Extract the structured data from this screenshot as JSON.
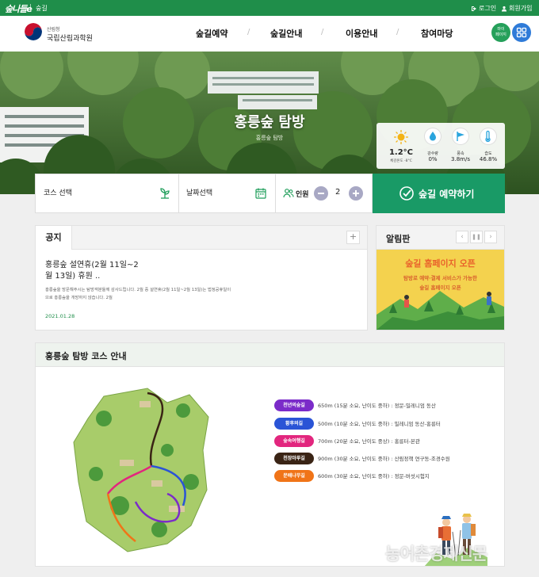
{
  "topbar": {
    "logo": "숲나들e",
    "breadcrumb": "숲길",
    "login": "로그인",
    "join": "회원가입"
  },
  "header": {
    "org_top": "산림청",
    "org_name": "국립산림과학원",
    "nav": [
      "숲길예약",
      "숲길안내",
      "이용안내",
      "참여마당"
    ],
    "mypage": [
      "마이",
      "페이지"
    ]
  },
  "hero": {
    "title": "홍릉숲 탐방",
    "subtitle": "홍릉숲 탐방"
  },
  "weather": {
    "temp": "1.2°C",
    "feels": "체감온도 -8°C",
    "items": [
      {
        "label": "강수량",
        "value": "0%",
        "icon": "raindrop-icon"
      },
      {
        "label": "풍속",
        "value": "3.8m/s",
        "icon": "wind-flag-icon"
      },
      {
        "label": "습도",
        "value": "46.8%",
        "icon": "humidity-icon"
      }
    ]
  },
  "search": {
    "course": "코스 선택",
    "date": "날짜선택",
    "people_label": "인원",
    "people_count": "2",
    "reserve": "숲길 예약하기"
  },
  "notice": {
    "tab": "공지",
    "plus": "+",
    "title": "홍릉숲 설연휴(2월 11일~2월 13일) 휴원 ..",
    "body": "홍릉숲을 방문해주시는 탐방객분들께 감사드립니다. 2월 중 설연휴(2월 11일~2월 13일)는 법정공휴일이므로 홍릉숲을 개방하지 않습니다. 2월",
    "date": "2021.01.28"
  },
  "board": {
    "tab": "알림판",
    "banner_title": "숲길 홈페이지 오픈",
    "banner_line1": "탐방로 예약·결제 서비스가 가능한",
    "banner_line2": "숲길 홈페이지 오픈"
  },
  "courses": {
    "tab": "홍릉숲 탐방 코스 안내",
    "items": [
      {
        "name": "천년의숲길",
        "color": "#7b2bc9",
        "desc": "650m (15분 소요, 난이도 중하) : 정문-밀레니엄 동산"
      },
      {
        "name": "황후의길",
        "color": "#2a54d6",
        "desc": "500m (10분 소요, 난이도 중하) : 밀레니엄 동산-홍릉터"
      },
      {
        "name": "숲속여행길",
        "color": "#e2267e",
        "desc": "700m (20분 소요, 난이도 중상) : 홍릉터-본관"
      },
      {
        "name": "천장마루길",
        "color": "#3a2415",
        "desc": "900m (30분 소요, 난이도 중하) : 산림정책 연구동-조경수원"
      },
      {
        "name": "문배나무길",
        "color": "#f07418",
        "desc": "600m (30분 소요, 난이도 중하) : 정문-버섯시험지"
      }
    ]
  },
  "watermark": "농어촌경제신문",
  "colors": {
    "green": "#1f8e4a",
    "reserve": "#199a66",
    "blue": "#2f7bd8"
  }
}
